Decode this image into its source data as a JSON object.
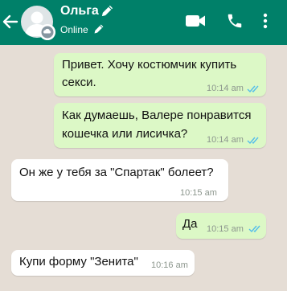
{
  "contact": {
    "name": "Ольга",
    "status": "Online"
  },
  "colors": {
    "header": "#008069",
    "background": "#e5ddd5",
    "outgoing_bubble": "#dcf8c6",
    "incoming_bubble": "#ffffff",
    "read_ticks": "#53bdeb"
  },
  "icons": {
    "back": "arrow-left-icon",
    "edit": "pencil-icon",
    "video": "video-camera-icon",
    "call": "phone-icon",
    "menu": "more-vertical-icon"
  },
  "messages": [
    {
      "direction": "outgoing",
      "lines": [
        "Привет. Хочу костюмчик купить",
        "секси."
      ],
      "time": "10:14 am",
      "read": true
    },
    {
      "direction": "outgoing",
      "lines": [
        "Как думаешь, Валере понравится",
        "кошечка или лисичка?"
      ],
      "time": "10:14 am",
      "read": true
    },
    {
      "direction": "incoming",
      "lines": [
        "Он же у тебя за \"Спартак\" болеет?"
      ],
      "time": "10:15 am"
    },
    {
      "direction": "outgoing",
      "lines": [
        "Да"
      ],
      "time": "10:15 am",
      "read": true
    },
    {
      "direction": "incoming",
      "lines": [
        "Купи форму \"Зенита\""
      ],
      "time": "10:16 am"
    }
  ]
}
